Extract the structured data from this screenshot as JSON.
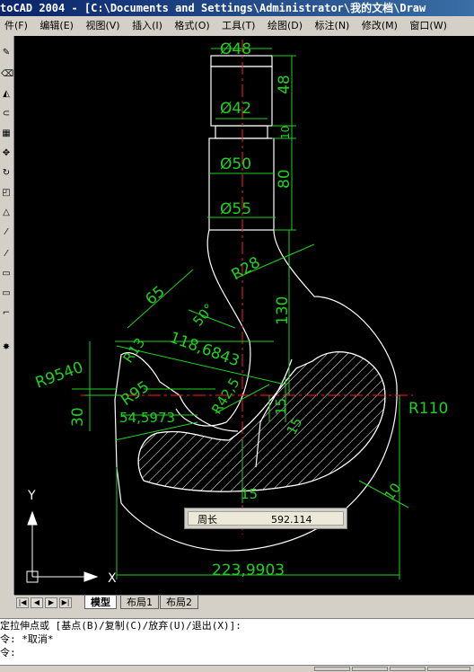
{
  "window": {
    "title": "toCAD 2004 - [C:\\Documents and Settings\\Administrator\\我的文档\\Draw"
  },
  "menu": [
    "件(F)",
    "编辑(E)",
    "视图(V)",
    "插入(I)",
    "格式(O)",
    "工具(T)",
    "绘图(D)",
    "标注(N)",
    "修改(M)",
    "窗口(W)"
  ],
  "toolbar_icons": [
    "pencil-icon",
    "erase-icon",
    "mirror-icon",
    "offset-icon",
    "array-icon",
    "move-icon",
    "rotate-icon",
    "scale-icon",
    "stretch-icon",
    "trim-icon",
    "extend-icon",
    "break-icon",
    "chamfer-icon",
    "fillet-icon",
    "explode-icon"
  ],
  "drawing": {
    "dims": {
      "d48": "Ø48",
      "d42": "Ø42",
      "d50": "Ø50",
      "d55": "Ø55",
      "v48": "48",
      "v10": "10",
      "v80": "80",
      "r28": "R28",
      "v130": "130",
      "v65": "65",
      "a50": "50°",
      "r13": "R13",
      "len118": "118,6843",
      "r9540": "R9540",
      "r95": "R95",
      "r42": "R42,5",
      "v15a": "15",
      "v15b": "15",
      "v30": "30",
      "len54": "54,5973",
      "r110": "R110",
      "v10b": "10",
      "v15c": "15",
      "width": "223,9903"
    },
    "ucs": {
      "y": "Y",
      "x": "X"
    }
  },
  "measure": {
    "label": "周长",
    "value": "592.114"
  },
  "tabs": {
    "model": "模型",
    "layout1": "布局1",
    "layout2": "布局2"
  },
  "command": {
    "line1": "定拉伸点或 [基点(B)/复制(C)/放弃(U)/退出(X)]:",
    "line2": "令: *取消*",
    "prompt": "令:"
  }
}
